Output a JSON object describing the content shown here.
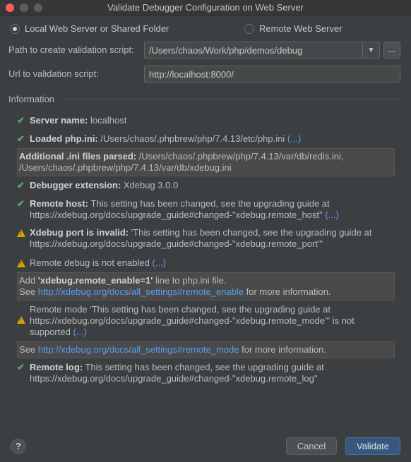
{
  "window": {
    "title": "Validate Debugger Configuration on Web Server"
  },
  "mode": {
    "local_label": "Local Web Server or Shared Folder",
    "remote_label": "Remote Web Server",
    "selected": "local"
  },
  "path": {
    "label": "Path to create validation script:",
    "value": "/Users/chaos/Work/php/demos/debug",
    "browse": "..."
  },
  "url": {
    "label": "Url to validation script:",
    "value": "http://localhost:8000/"
  },
  "info": {
    "heading": "Information",
    "server_name": {
      "key": "Server name:",
      "value": " localhost"
    },
    "loaded_ini": {
      "key": "Loaded php.ini:",
      "value": " /Users/chaos/.phpbrew/php/7.4.13/etc/php.ini ",
      "more": "(...)"
    },
    "additional_ini": {
      "key": "Additional .ini files parsed:",
      "value1": " /Users/chaos/.phpbrew/php/7.4.13/var/db/redis.ini,",
      "value2": "/Users/chaos/.phpbrew/php/7.4.13/var/db/xdebug.ini"
    },
    "debugger_ext": {
      "key": "Debugger extension:",
      "value": " Xdebug 3.0.0"
    },
    "remote_host": {
      "key": "Remote host:",
      "value1": " This setting has been changed, see the upgrading guide at",
      "value2": "https://xdebug.org/docs/upgrade_guide#changed-\"xdebug.remote_host\" ",
      "more": "(...)"
    },
    "port_invalid": {
      "key": "Xdebug port is invalid:",
      "value1": " 'This setting has been changed, see the upgrading guide at",
      "value2": "https://xdebug.org/docs/upgrade_guide#changed-\"xdebug.remote_port\"'"
    },
    "remote_debug": {
      "text": "Remote debug is not enabled ",
      "more": "(...)"
    },
    "remote_enable_box": {
      "pre": "Add ",
      "key": "'xdebug.remote_enable=1'",
      "post": " line to php.ini file.",
      "see": "See ",
      "link": "http://xdebug.org/docs/all_settings#remote_enable",
      "tail": " for more information."
    },
    "remote_mode": {
      "line1": "Remote mode 'This setting has been changed, see the upgrading guide at",
      "line2": "https://xdebug.org/docs/upgrade_guide#changed-\"xdebug.remote_mode\"' is not",
      "line3": "supported ",
      "more": "(...)"
    },
    "remote_mode_box": {
      "see": "See ",
      "link": "http://xdebug.org/docs/all_settings#remote_mode",
      "tail": " for more information."
    },
    "remote_log": {
      "key": "Remote log:",
      "value1": " This setting has been changed, see the upgrading guide at",
      "value2": "https://xdebug.org/docs/upgrade_guide#changed-\"xdebug.remote_log\""
    }
  },
  "buttons": {
    "help": "?",
    "cancel": "Cancel",
    "validate": "Validate"
  },
  "colors": {
    "ok": "#59a869",
    "warn": "#e0a000",
    "link": "#589df6",
    "primary": "#365880"
  }
}
